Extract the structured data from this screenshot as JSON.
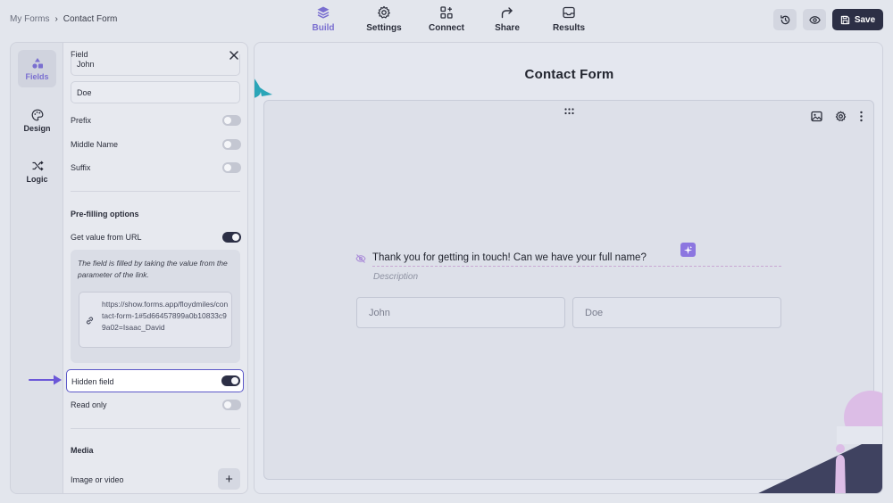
{
  "breadcrumb": {
    "root": "My Forms",
    "separator": "›",
    "current": "Contact Form"
  },
  "nav": [
    {
      "label": "Build",
      "icon": "layers-icon",
      "active": true
    },
    {
      "label": "Settings",
      "icon": "gear-icon",
      "active": false
    },
    {
      "label": "Connect",
      "icon": "plus-grid-icon",
      "active": false
    },
    {
      "label": "Share",
      "icon": "share-arrow-icon",
      "active": false
    },
    {
      "label": "Results",
      "icon": "inbox-icon",
      "active": false
    }
  ],
  "toolbar": {
    "history_icon": "history-icon",
    "preview_icon": "eye-icon",
    "save_label": "Save"
  },
  "rail": [
    {
      "label": "Fields",
      "icon": "shapes-icon",
      "active": true
    },
    {
      "label": "Design",
      "icon": "palette-icon",
      "active": false
    },
    {
      "label": "Logic",
      "icon": "shuffle-icon",
      "active": false
    }
  ],
  "panel": {
    "field_label": "Field",
    "first_value": "John",
    "last_value": "Doe",
    "toggles": {
      "prefix": {
        "label": "Prefix",
        "on": false
      },
      "middle_name": {
        "label": "Middle Name",
        "on": false
      },
      "suffix": {
        "label": "Suffix",
        "on": false
      }
    },
    "prefill_heading": "Pre-filling options",
    "get_value_url": {
      "label": "Get value from URL",
      "on": true
    },
    "info_text": "The field is filled by taking the value from the parameter of the link.",
    "url": "https://show.forms.app/floydmiles/contact-form-1#5d66457899a0b10833c99a02=Isaac_David",
    "hidden_field": {
      "label": "Hidden field",
      "on": true
    },
    "read_only": {
      "label": "Read only",
      "on": false
    },
    "media_heading": "Media",
    "image_video_label": "Image or video",
    "add_label": "+"
  },
  "canvas": {
    "form_title": "Contact Form",
    "question": "Thank you for getting in touch! Can we have your full name?",
    "description_placeholder": "Description",
    "first_placeholder": "John",
    "last_placeholder": "Doe"
  },
  "colors": {
    "accent": "#7a6fd0",
    "dark": "#2c2f45",
    "highlight_border": "#5b57c8"
  }
}
